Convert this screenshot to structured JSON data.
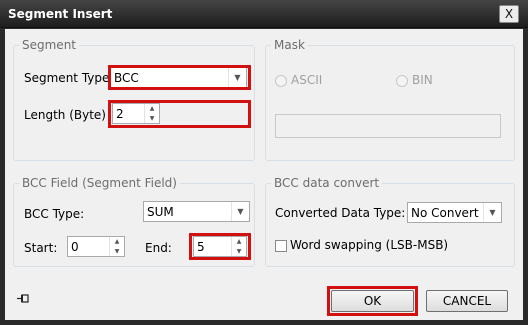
{
  "window": {
    "title": "Segment Insert",
    "close_glyph": "X"
  },
  "segment": {
    "legend": "Segment",
    "type_label": "Segment Type",
    "type_value": "BCC",
    "length_label": "Length (Byte)",
    "length_value": "2"
  },
  "mask": {
    "legend": "Mask",
    "ascii_label": "ASCII",
    "bin_label": "BIN",
    "value": ""
  },
  "bcc_field": {
    "legend": "BCC Field (Segment Field)",
    "type_label": "BCC Type:",
    "type_value": "SUM",
    "start_label": "Start:",
    "start_value": "0",
    "end_label": "End:",
    "end_value": "5"
  },
  "bcc_convert": {
    "legend": "BCC data convert",
    "converted_label": "Converted Data Type:",
    "converted_value": "No Convert",
    "swap_label": "Word swapping (LSB-MSB)"
  },
  "buttons": {
    "ok": "OK",
    "cancel": "CANCEL"
  },
  "icons": {
    "pin": "pin-icon",
    "close": "close-icon",
    "dropdown": "chevron-down-icon"
  },
  "colors": {
    "highlight": "#d21010",
    "titlebar": "#2a2a2a"
  }
}
